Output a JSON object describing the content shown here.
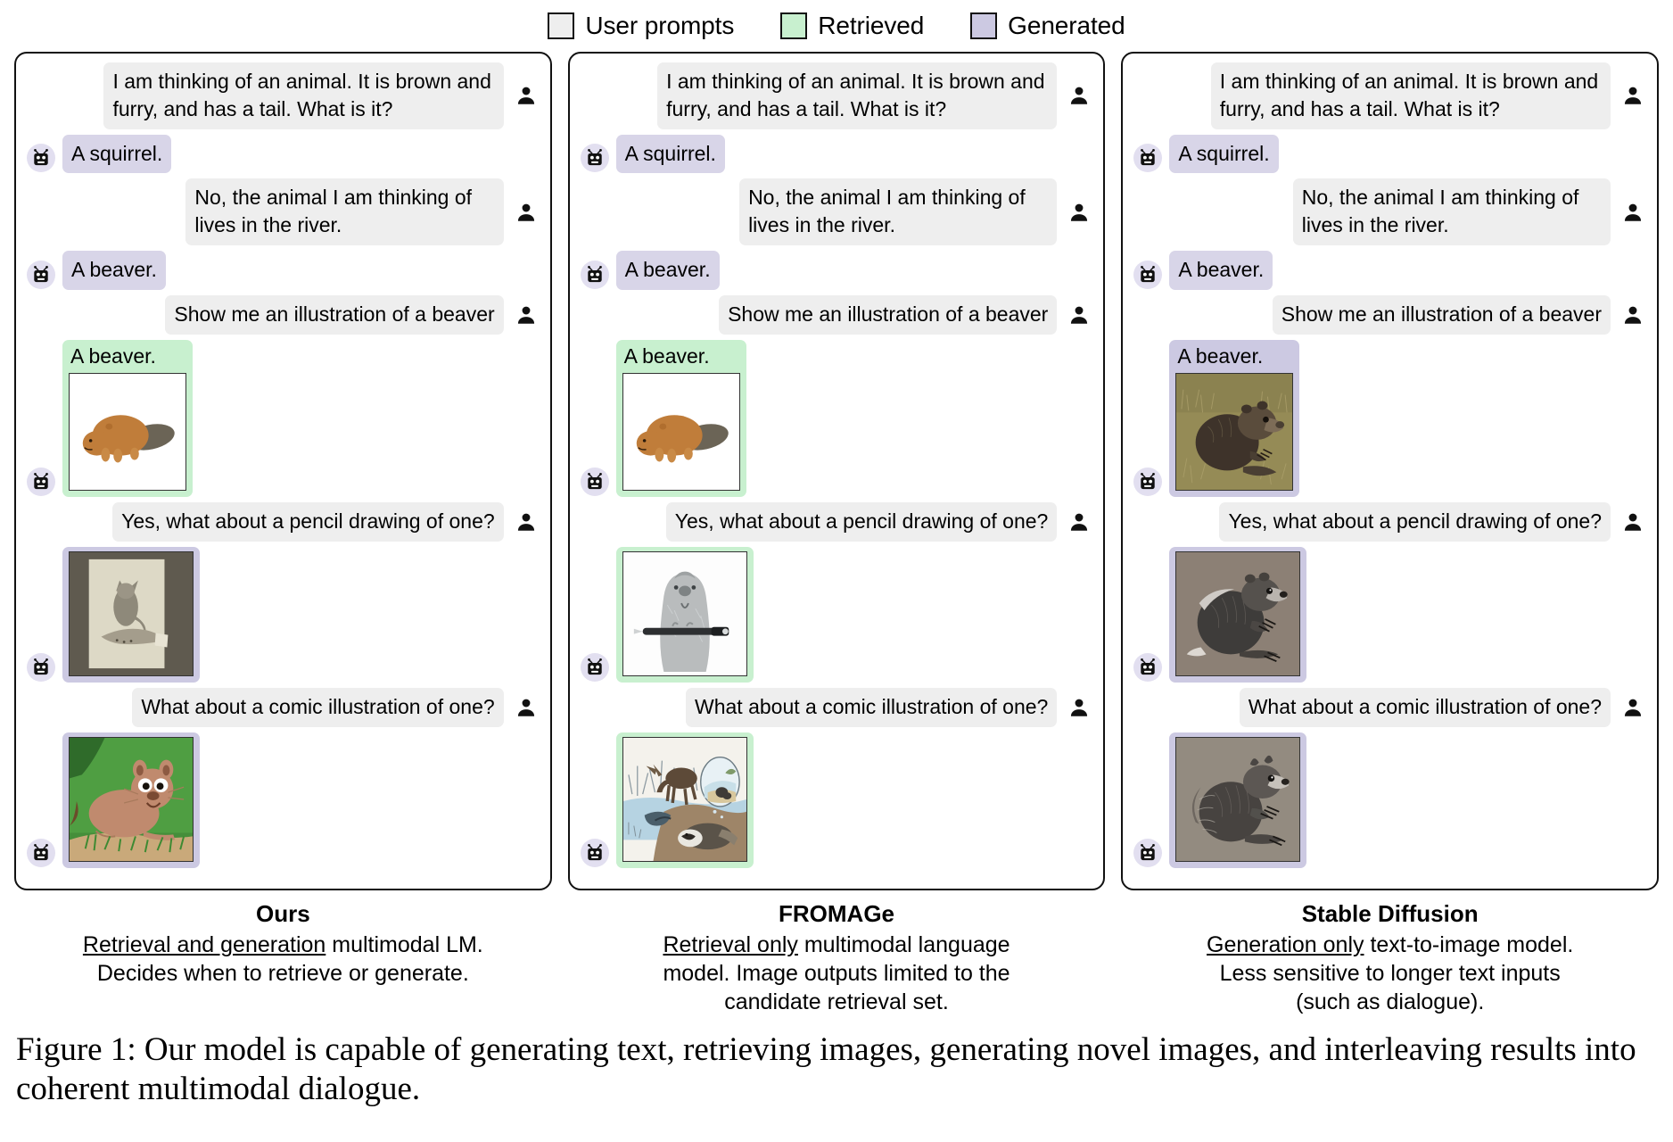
{
  "legend": {
    "items": [
      {
        "label": "User prompts",
        "color": "#eeeeee",
        "name": "user-prompts"
      },
      {
        "label": "Retrieved",
        "color": "#c8f0cf",
        "name": "retrieved"
      },
      {
        "label": "Generated",
        "color": "#ccc9e2",
        "name": "generated"
      }
    ]
  },
  "panels": [
    {
      "id": "ours",
      "caption_title": "Ours",
      "caption_underlined": "Retrieval and generation",
      "caption_rest": " multimodal LM.",
      "caption_line2": "Decides when to retrieve or generate.",
      "messages": [
        {
          "role": "user",
          "type": "text",
          "text": "I am thinking of an animal. It is brown and furry, and has a tail. What is it?"
        },
        {
          "role": "bot",
          "type": "text",
          "kind": "generated",
          "text": "A squirrel."
        },
        {
          "role": "user",
          "type": "text",
          "text": "No, the animal I am thinking of lives in the river."
        },
        {
          "role": "bot",
          "type": "text",
          "kind": "generated",
          "text": "A beaver."
        },
        {
          "role": "user",
          "type": "text",
          "text": "Show me an illustration of a beaver"
        },
        {
          "role": "bot",
          "type": "image",
          "kind": "retrieved",
          "caption": "A beaver.",
          "image": "clipart-beaver-brown"
        },
        {
          "role": "user",
          "type": "text",
          "text": "Yes, what about a pencil drawing of one?"
        },
        {
          "role": "bot",
          "type": "image",
          "kind": "generated",
          "caption": "",
          "image": "sepia-photo-squirrel-on-hand"
        },
        {
          "role": "user",
          "type": "text",
          "text": "What about a comic illustration of one?"
        },
        {
          "role": "bot",
          "type": "image",
          "kind": "generated",
          "caption": "",
          "image": "cartoon-beaver-green-grass"
        }
      ]
    },
    {
      "id": "fromage",
      "caption_title": "FROMAGe",
      "caption_underlined": "Retrieval only",
      "caption_rest": " multimodal language",
      "caption_line2": "model. Image outputs limited to the",
      "caption_line3": "candidate retrieval set.",
      "messages": [
        {
          "role": "user",
          "type": "text",
          "text": "I am thinking of an animal. It is brown and furry, and has a tail. What is it?"
        },
        {
          "role": "bot",
          "type": "text",
          "kind": "generated",
          "text": "A squirrel."
        },
        {
          "role": "user",
          "type": "text",
          "text": "No, the animal I am thinking of lives in the river."
        },
        {
          "role": "bot",
          "type": "text",
          "kind": "generated",
          "text": "A beaver."
        },
        {
          "role": "user",
          "type": "text",
          "text": "Show me an illustration of a beaver"
        },
        {
          "role": "bot",
          "type": "image",
          "kind": "retrieved",
          "caption": "A beaver.",
          "image": "clipart-beaver-brown"
        },
        {
          "role": "user",
          "type": "text",
          "text": "Yes, what about a pencil drawing of one?"
        },
        {
          "role": "bot",
          "type": "image",
          "kind": "retrieved",
          "caption": "",
          "image": "grey-beaver-holding-pen"
        },
        {
          "role": "user",
          "type": "text",
          "text": "What about a comic illustration of one?"
        },
        {
          "role": "bot",
          "type": "image",
          "kind": "retrieved",
          "caption": "",
          "image": "watercolour-wetland-scene"
        }
      ]
    },
    {
      "id": "stable-diffusion",
      "caption_title": "Stable Diffusion",
      "caption_underlined": "Generation only",
      "caption_rest": " text-to-image model.",
      "caption_line2": "Less sensitive to longer text inputs",
      "caption_line3": "(such as dialogue).",
      "messages": [
        {
          "role": "user",
          "type": "text",
          "text": "I am thinking of an animal. It is brown and furry, and has a tail. What is it?"
        },
        {
          "role": "bot",
          "type": "text",
          "kind": "generated",
          "text": "A squirrel."
        },
        {
          "role": "user",
          "type": "text",
          "text": "No, the animal I am thinking of lives in the river."
        },
        {
          "role": "bot",
          "type": "text",
          "kind": "generated",
          "text": "A beaver."
        },
        {
          "role": "user",
          "type": "text",
          "text": "Show me an illustration of a beaver"
        },
        {
          "role": "bot",
          "type": "image",
          "kind": "generated",
          "caption": "A beaver.",
          "image": "painted-brown-beaver-grass"
        },
        {
          "role": "user",
          "type": "text",
          "text": "Yes, what about a pencil drawing of one?"
        },
        {
          "role": "bot",
          "type": "image",
          "kind": "generated",
          "caption": "",
          "image": "pencil-grey-rodent"
        },
        {
          "role": "user",
          "type": "text",
          "text": "What about a comic illustration of one?"
        },
        {
          "role": "bot",
          "type": "image",
          "kind": "generated",
          "caption": "",
          "image": "pencil-grey-squirrel"
        }
      ]
    }
  ],
  "figure_caption": {
    "label": "Figure 1:",
    "text": " Our model is capable of generating text, retrieving images, generating novel images, and interleaving results into coherent multimodal dialogue."
  },
  "icons": {
    "bot": "robot-avatar-icon",
    "user": "user-avatar-icon"
  }
}
